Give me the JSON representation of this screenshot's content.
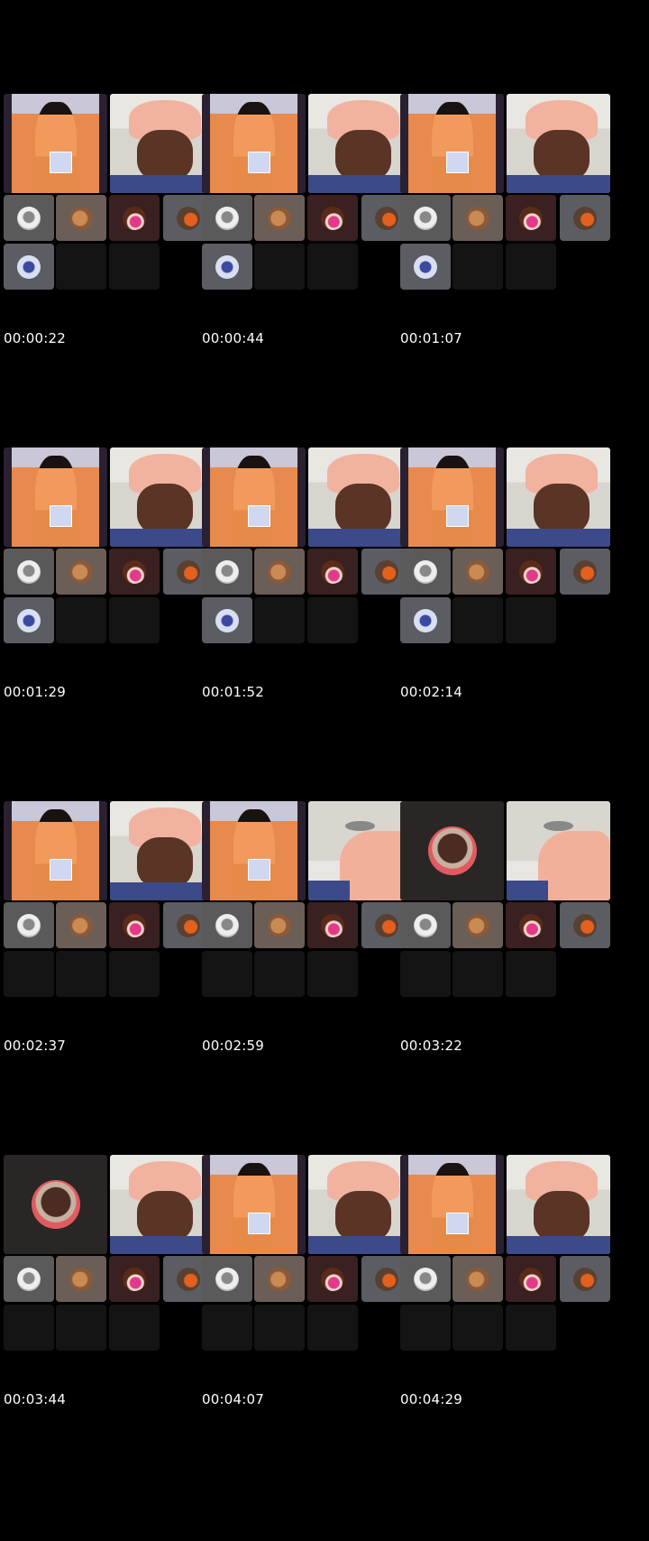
{
  "timestamps": [
    "00:00:22",
    "00:00:44",
    "00:01:07",
    "00:01:29",
    "00:01:52",
    "00:02:14",
    "00:02:37",
    "00:02:59",
    "00:03:22",
    "00:03:44",
    "00:04:07",
    "00:04:29"
  ],
  "frames": [
    {
      "left": "orange",
      "right": "face",
      "row3": [
        "blue",
        "empty",
        "empty"
      ]
    },
    {
      "left": "orange",
      "right": "face",
      "row3": [
        "blue",
        "empty",
        "empty"
      ]
    },
    {
      "left": "orange",
      "right": "face",
      "row3": [
        "blue",
        "empty",
        "empty"
      ]
    },
    {
      "left": "orange",
      "right": "face",
      "row3": [
        "blue",
        "empty",
        "empty"
      ]
    },
    {
      "left": "orange",
      "right": "face",
      "row3": [
        "blue",
        "empty",
        "empty"
      ]
    },
    {
      "left": "orange",
      "right": "face",
      "row3": [
        "blue",
        "empty",
        "empty"
      ]
    },
    {
      "left": "orange",
      "right": "face",
      "row3": [
        "empty",
        "empty",
        "empty"
      ]
    },
    {
      "left": "orange",
      "right": "kitchen",
      "row3": [
        "empty",
        "empty",
        "empty"
      ]
    },
    {
      "left": "avatar",
      "right": "kitchen",
      "row3": [
        "empty",
        "empty",
        "empty"
      ]
    },
    {
      "left": "avatar",
      "right": "face",
      "row3": [
        "empty",
        "empty",
        "empty"
      ]
    },
    {
      "left": "orange",
      "right": "face",
      "row3": [
        "empty",
        "empty",
        "empty"
      ]
    },
    {
      "left": "orange",
      "right": "face",
      "row3": [
        "empty",
        "empty",
        "empty"
      ]
    }
  ],
  "row2_avatars": [
    "white",
    "bread",
    "pink",
    "orange"
  ],
  "colors": {
    "background": "#000000",
    "timestamp_text": "#ffffff"
  }
}
